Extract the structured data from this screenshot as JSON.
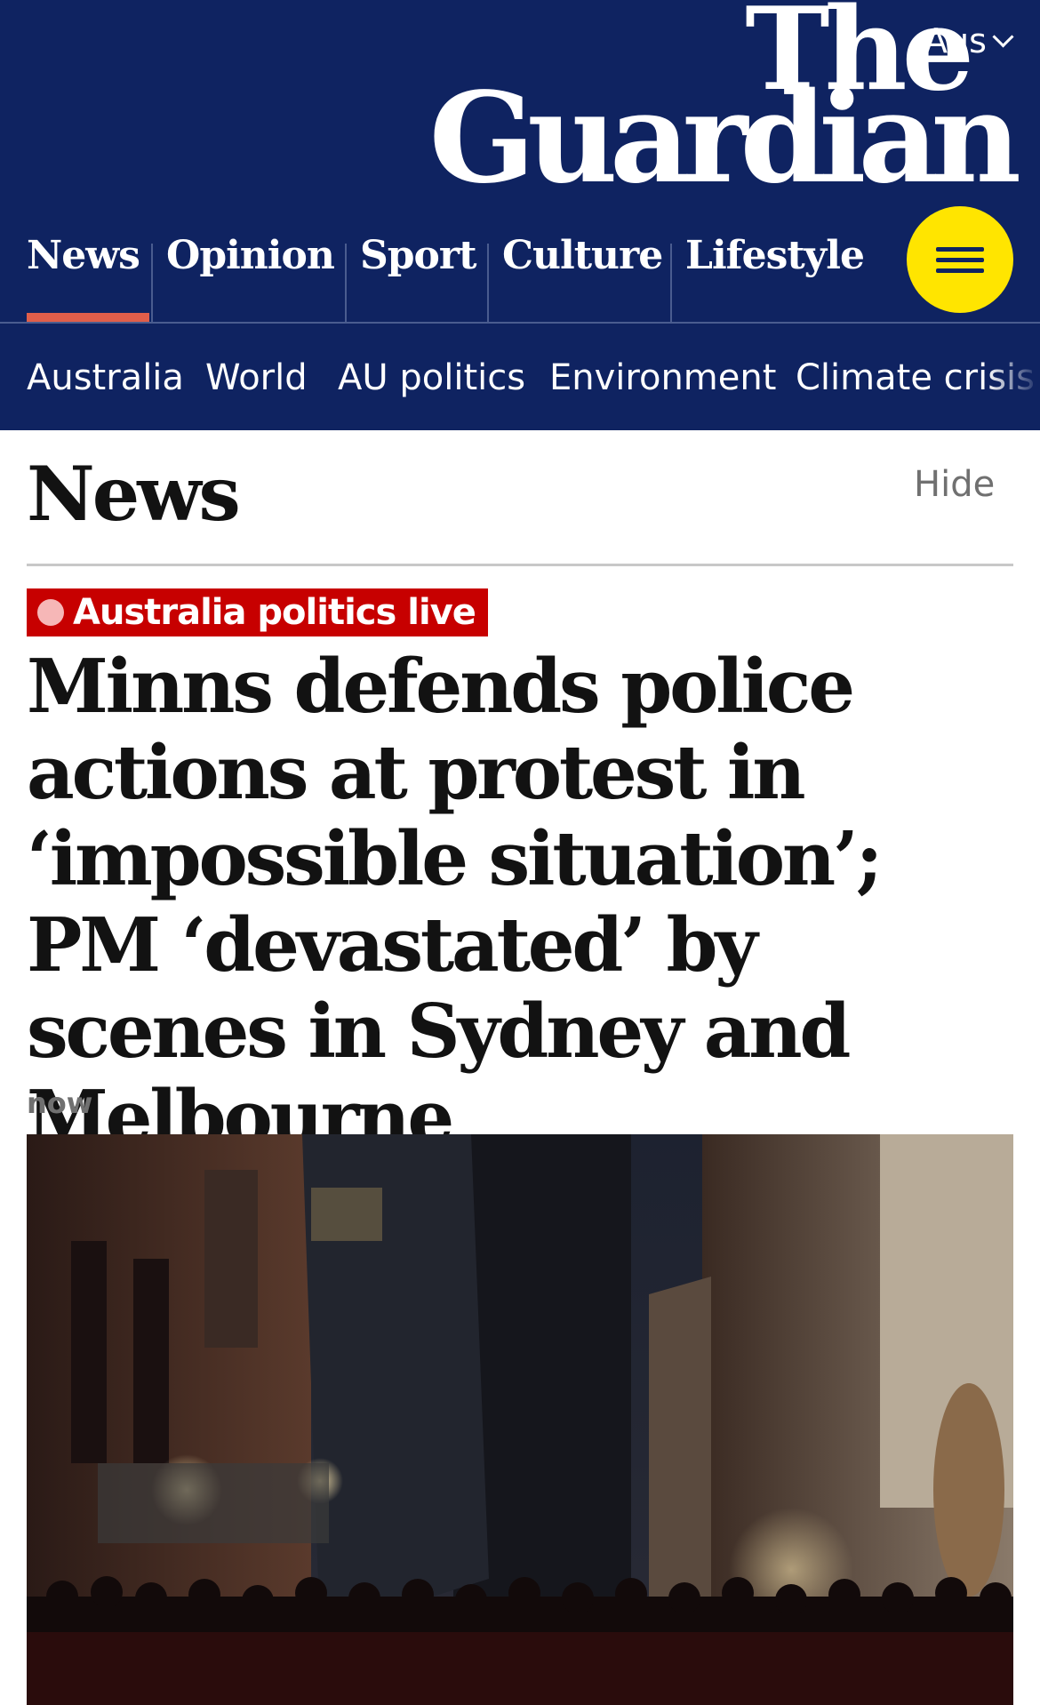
{
  "header": {
    "edition": "Aus",
    "logo": {
      "line1": "The",
      "line2": "Guardian"
    },
    "pillars": [
      {
        "label": "News",
        "active": true
      },
      {
        "label": "Opinion",
        "active": false
      },
      {
        "label": "Sport",
        "active": false
      },
      {
        "label": "Culture",
        "active": false
      },
      {
        "label": "Lifestyle",
        "active": false
      }
    ],
    "subnav": [
      "Australia",
      "World",
      "AU politics",
      "Environment",
      "Climate crisis"
    ],
    "colors": {
      "brand": "#0f2361",
      "accent": "#e05e4a",
      "menu": "#ffe500"
    },
    "menu_icon": "hamburger-icon",
    "edition_icon": "chevron-down-icon"
  },
  "section": {
    "title": "News",
    "hide_label": "Hide"
  },
  "article": {
    "kicker": "Australia politics live",
    "kicker_color": "#c70000",
    "headline": "Minns defends police actions at protest in ‘impossible situation’; PM ‘devastated’ by scenes in Sydney and Melbourne",
    "timestamp": "now"
  }
}
